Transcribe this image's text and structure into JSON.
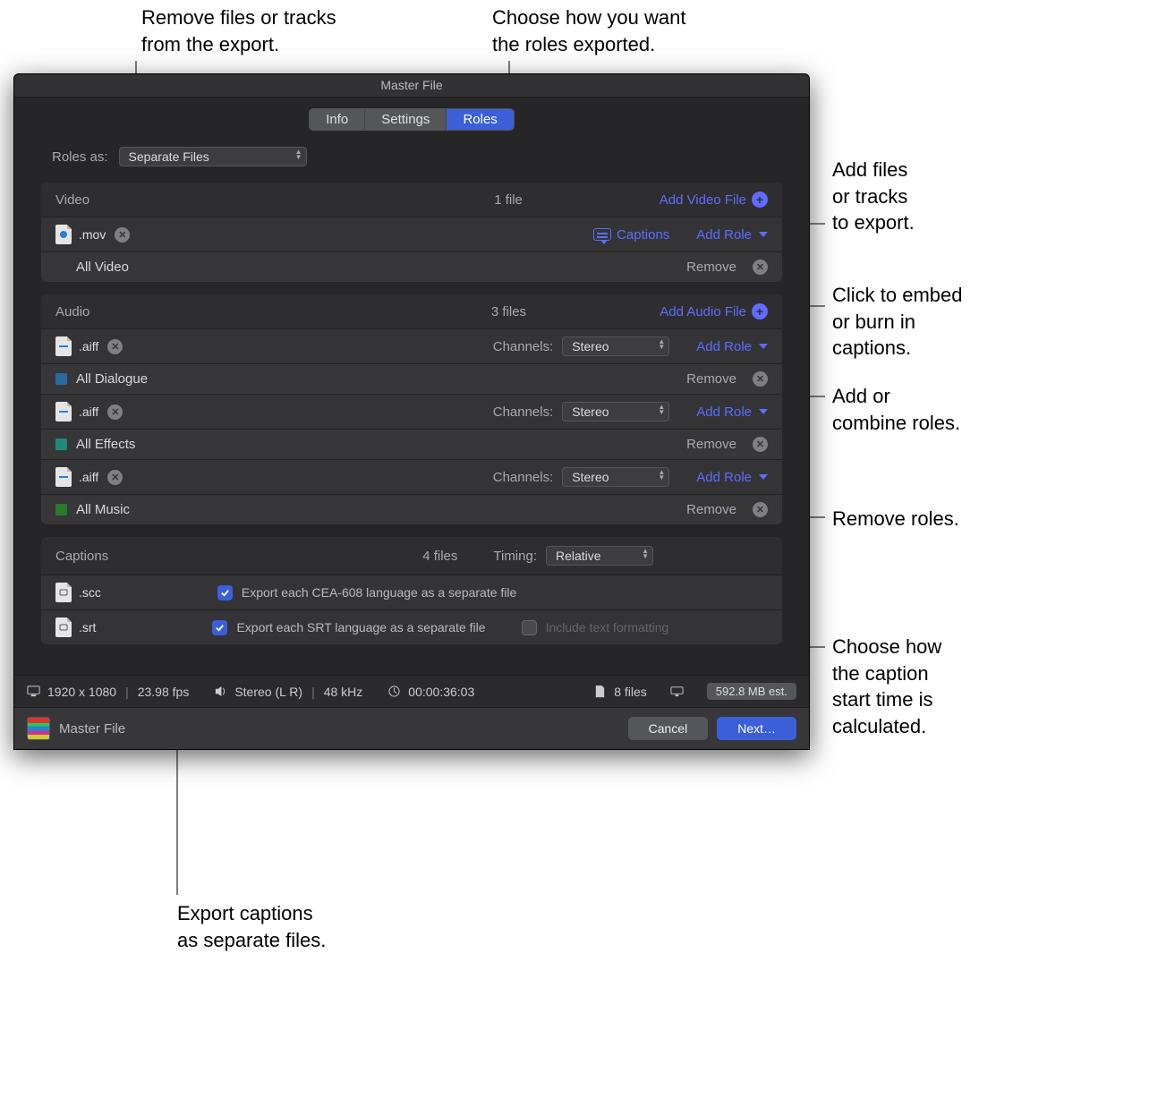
{
  "callouts": {
    "remove_files": "Remove files or tracks\nfrom the export.",
    "choose_export": "Choose how you want\nthe roles exported.",
    "add_files": "Add files\nor tracks\nto export.",
    "embed_captions": "Click to embed\nor burn in\ncaptions.",
    "add_combine": "Add or\ncombine roles.",
    "remove_roles": "Remove roles.",
    "timing": "Choose how\nthe caption\nstart time is\ncalculated.",
    "export_captions": "Export captions\nas separate files."
  },
  "window_title": "Master File",
  "tabs": {
    "info": "Info",
    "settings": "Settings",
    "roles": "Roles"
  },
  "roles_as": {
    "label": "Roles as:",
    "value": "Separate Files"
  },
  "video": {
    "title": "Video",
    "count": "1 file",
    "add_label": "Add Video File",
    "file": {
      "ext": ".mov",
      "captions_label": "Captions",
      "add_role": "Add Role"
    },
    "role": {
      "name": "All Video",
      "swatch": "#3c4a8a",
      "remove": "Remove"
    }
  },
  "audio": {
    "title": "Audio",
    "count": "3 files",
    "add_label": "Add Audio File",
    "channels_label": "Channels:",
    "add_role": "Add Role",
    "remove": "Remove",
    "files": [
      {
        "ext": ".aiff",
        "channels": "Stereo",
        "role": {
          "name": "All Dialogue",
          "swatch": "#2a6aa0"
        }
      },
      {
        "ext": ".aiff",
        "channels": "Stereo",
        "role": {
          "name": "All Effects",
          "swatch": "#1f8a7a"
        }
      },
      {
        "ext": ".aiff",
        "channels": "Stereo",
        "role": {
          "name": "All Music",
          "swatch": "#2b7a2b"
        }
      }
    ]
  },
  "captions": {
    "title": "Captions",
    "count": "4 files",
    "timing_label": "Timing:",
    "timing_value": "Relative",
    "rows": [
      {
        "ext": ".scc",
        "checkbox_label": "Export each CEA-608 language as a separate file"
      },
      {
        "ext": ".srt",
        "checkbox_label": "Export each SRT language as a separate file",
        "extra_label": "Include text formatting"
      }
    ]
  },
  "status": {
    "resolution": "1920 x 1080",
    "fps": "23.98 fps",
    "audio": "Stereo (L R)",
    "khz": "48 kHz",
    "duration": "00:00:36:03",
    "file_count": "8 files",
    "estimate": "592.8 MB est."
  },
  "footer": {
    "name": "Master File",
    "cancel": "Cancel",
    "next": "Next…"
  }
}
